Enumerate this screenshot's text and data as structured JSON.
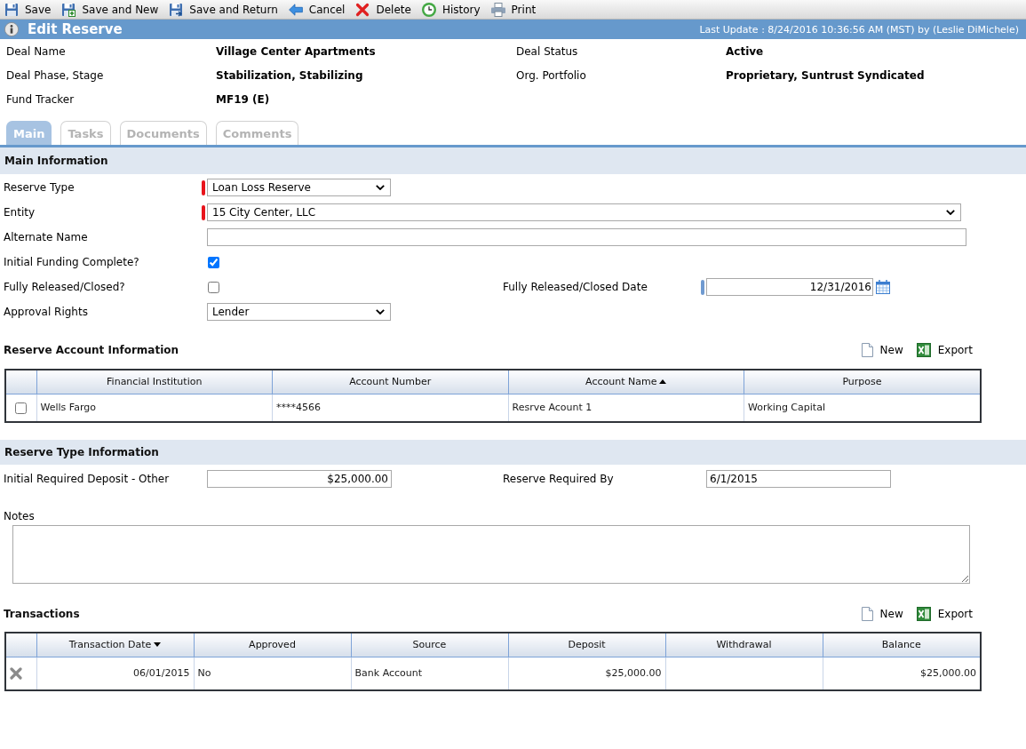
{
  "toolbar": [
    {
      "label": "Save"
    },
    {
      "label": "Save and New"
    },
    {
      "label": "Save and Return"
    },
    {
      "label": "Cancel"
    },
    {
      "label": "Delete"
    },
    {
      "label": "History"
    },
    {
      "label": "Print"
    }
  ],
  "header": {
    "title": "Edit Reserve",
    "last_update": "Last Update : 8/24/2016 10:36:56 AM (MST) by (Leslie DiMichele)"
  },
  "deal_info": [
    {
      "label": "Deal Name",
      "value": "Village Center Apartments"
    },
    {
      "label": "Deal Status",
      "value": "Active"
    },
    {
      "label": "Deal Phase, Stage",
      "value": "Stabilization, Stabilizing"
    },
    {
      "label": "Org. Portfolio",
      "value": "Proprietary, Suntrust Syndicated"
    },
    {
      "label": "Fund Tracker",
      "value": "MF19 (E)"
    }
  ],
  "tabs": [
    {
      "label": "Main",
      "selected": true
    },
    {
      "label": "Tasks",
      "selected": false
    },
    {
      "label": "Documents",
      "selected": false
    },
    {
      "label": "Comments",
      "selected": false
    }
  ],
  "main_information": {
    "title": "Main Information",
    "rows": [
      {
        "fields": [
          {
            "kind": "select",
            "label": "Reserve Type",
            "value": "Loan Loss Reserve",
            "required": true,
            "conditionally_required": false
          }
        ]
      },
      {
        "fields": [
          {
            "kind": "select",
            "label": "Entity",
            "value": "15 City Center, LLC",
            "required": true,
            "conditionally_required": false
          }
        ]
      },
      {
        "fields": [
          {
            "kind": "text",
            "label": "Alternate Name",
            "required": false,
            "conditionally_required": false
          }
        ]
      },
      {
        "fields": [
          {
            "kind": "checkbox",
            "label": "Initial Funding Complete?",
            "checked": true,
            "required": false,
            "conditionally_required": false
          }
        ]
      },
      {
        "fields": [
          {
            "kind": "checkbox",
            "label": "Fully Released/Closed?",
            "checked": false,
            "required": false,
            "conditionally_required": false
          },
          {
            "kind": "date",
            "label": "Fully Released/Closed Date",
            "value": "12/31/2016",
            "required": false,
            "conditionally_required": true
          }
        ]
      },
      {
        "fields": [
          {
            "kind": "select",
            "label": "Approval Rights",
            "value": "Lender",
            "required": false,
            "conditionally_required": false
          }
        ]
      }
    ]
  },
  "reserve_accounts": {
    "title": "Reserve Account Information",
    "actions": [
      {
        "label": "New"
      },
      {
        "label": "Export"
      }
    ],
    "columns": [
      {
        "label": "Financial Institution",
        "sorted": false
      },
      {
        "label": "Account Number",
        "sorted": false
      },
      {
        "label": "Account Name",
        "sorted": true,
        "descending": false
      },
      {
        "label": "Purpose",
        "sorted": false
      }
    ],
    "rows": [
      {
        "checked": false,
        "cells": [
          "Wells Fargo",
          "****4566",
          "Resrve Acount 1",
          "Working Capital"
        ]
      }
    ]
  },
  "reserve_type_information": {
    "title": "Reserve Type Information",
    "rows": [
      {
        "fields": [
          {
            "kind": "money",
            "label": "Initial Required Deposit - Other",
            "value": "$25,000.00",
            "required": false,
            "conditionally_required": false
          },
          {
            "kind": "text",
            "label": "Reserve Required By",
            "value": "6/1/2015",
            "required": false,
            "conditionally_required": false
          }
        ]
      }
    ],
    "notes": {
      "label": "Notes"
    }
  },
  "transactions": {
    "title": "Transactions",
    "actions": [
      {
        "label": "New"
      },
      {
        "label": "Export"
      }
    ],
    "columns": [
      {
        "label": "Transaction Date",
        "sorted": true,
        "descending": true
      },
      {
        "label": "Approved",
        "sorted": false
      },
      {
        "label": "Source",
        "sorted": false
      },
      {
        "label": "Deposit",
        "sorted": false
      },
      {
        "label": "Withdrawal",
        "sorted": false
      },
      {
        "label": "Balance",
        "sorted": false
      }
    ],
    "rows": [
      {
        "cells": [
          "06/01/2015",
          "No",
          "Bank Account",
          "$25,000.00",
          null,
          "$25,000.00"
        ]
      }
    ]
  }
}
